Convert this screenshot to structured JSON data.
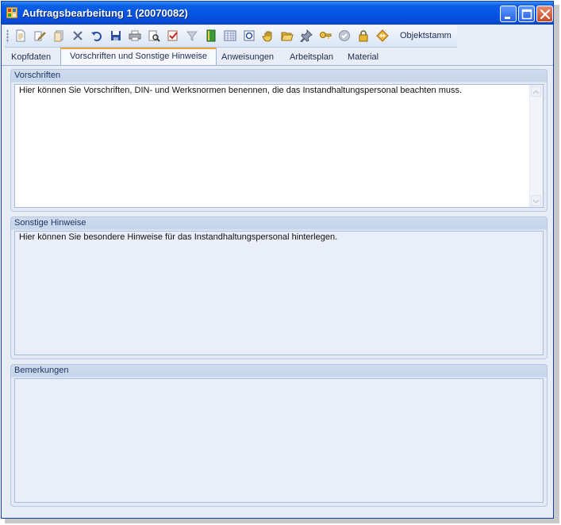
{
  "window": {
    "title": "Auftragsbearbeitung 1 (20070082)",
    "accent": "#0554e2"
  },
  "toolbar": {
    "icons": [
      "new-document-icon",
      "edit-icon",
      "copy-icon",
      "delete-icon",
      "undo-icon",
      "save-icon",
      "print-icon",
      "print-preview-icon",
      "checklist-icon",
      "filter-icon",
      "book-icon",
      "table-icon",
      "catalog-icon",
      "hand-icon",
      "folder-open-icon",
      "pin-icon",
      "keys-icon",
      "approve-icon",
      "lock-icon",
      "navigate-icon"
    ],
    "objektstamm_label": "Objektstamm"
  },
  "tabs": [
    {
      "label": "Kopfdaten",
      "active": false
    },
    {
      "label": "Vorschriften und Sonstige Hinweise",
      "active": true
    },
    {
      "label": "Anweisungen",
      "active": false
    },
    {
      "label": "Arbeitsplan",
      "active": false
    },
    {
      "label": "Material",
      "active": false
    }
  ],
  "sections": {
    "vorschriften": {
      "title": "Vorschriften",
      "text": "Hier können Sie Vorschriften, DIN- und Werksnormen benennen, die das Instandhaltungspersonal beachten muss."
    },
    "sonstige": {
      "title": "Sonstige Hinweise",
      "text": "Hier können Sie besondere Hinweise für das Instandhaltungspersonal hinterlegen."
    },
    "bemerkungen": {
      "title": "Bemerkungen",
      "text": ""
    }
  }
}
